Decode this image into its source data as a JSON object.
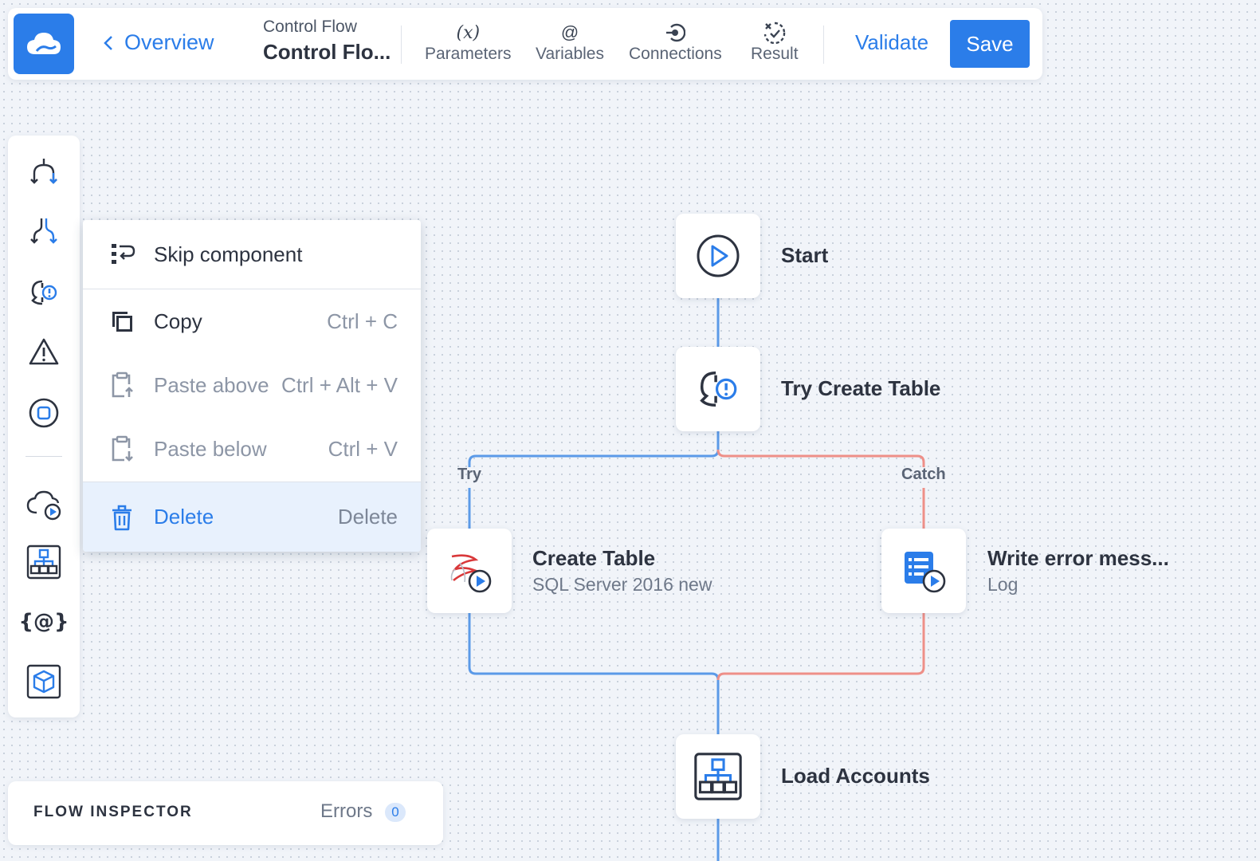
{
  "header": {
    "back_label": "Overview",
    "breadcrumb_small": "Control Flow",
    "breadcrumb_title": "Control Flo...",
    "tools": [
      {
        "label": "Parameters",
        "icon": "(x)"
      },
      {
        "label": "Variables",
        "icon": "@"
      },
      {
        "label": "Connections",
        "icon": "connections-icon"
      },
      {
        "label": "Result",
        "icon": "result-icon"
      }
    ],
    "validate_label": "Validate",
    "save_label": "Save"
  },
  "toolbox": {
    "variables_glyph": "{@}"
  },
  "context_menu": {
    "items": [
      {
        "label": "Skip component",
        "shortcut": "",
        "state": "normal"
      },
      {
        "label": "Copy",
        "shortcut": "Ctrl + C",
        "state": "normal"
      },
      {
        "label": "Paste above",
        "shortcut": "Ctrl + Alt + V",
        "state": "disabled"
      },
      {
        "label": "Paste below",
        "shortcut": "Ctrl + V",
        "state": "disabled"
      },
      {
        "label": "Delete",
        "shortcut": "Delete",
        "state": "highlighted"
      }
    ]
  },
  "flow": {
    "nodes": [
      {
        "title": "Start",
        "subtitle": ""
      },
      {
        "title": "Try Create Table",
        "subtitle": ""
      },
      {
        "title": "Create Table",
        "subtitle": "SQL Server 2016 new"
      },
      {
        "title": "Write error mess...",
        "subtitle": "Log"
      },
      {
        "title": "Load Accounts",
        "subtitle": ""
      }
    ],
    "branch_labels": {
      "try": "Try",
      "catch": "Catch"
    }
  },
  "inspector": {
    "title": "FLOW INSPECTOR",
    "errors_label": "Errors",
    "errors_count": "0"
  },
  "colors": {
    "accent": "#2b7de9",
    "try_line": "#5b9ae8",
    "catch_line": "#ee8f88",
    "text": "#2d3340"
  }
}
